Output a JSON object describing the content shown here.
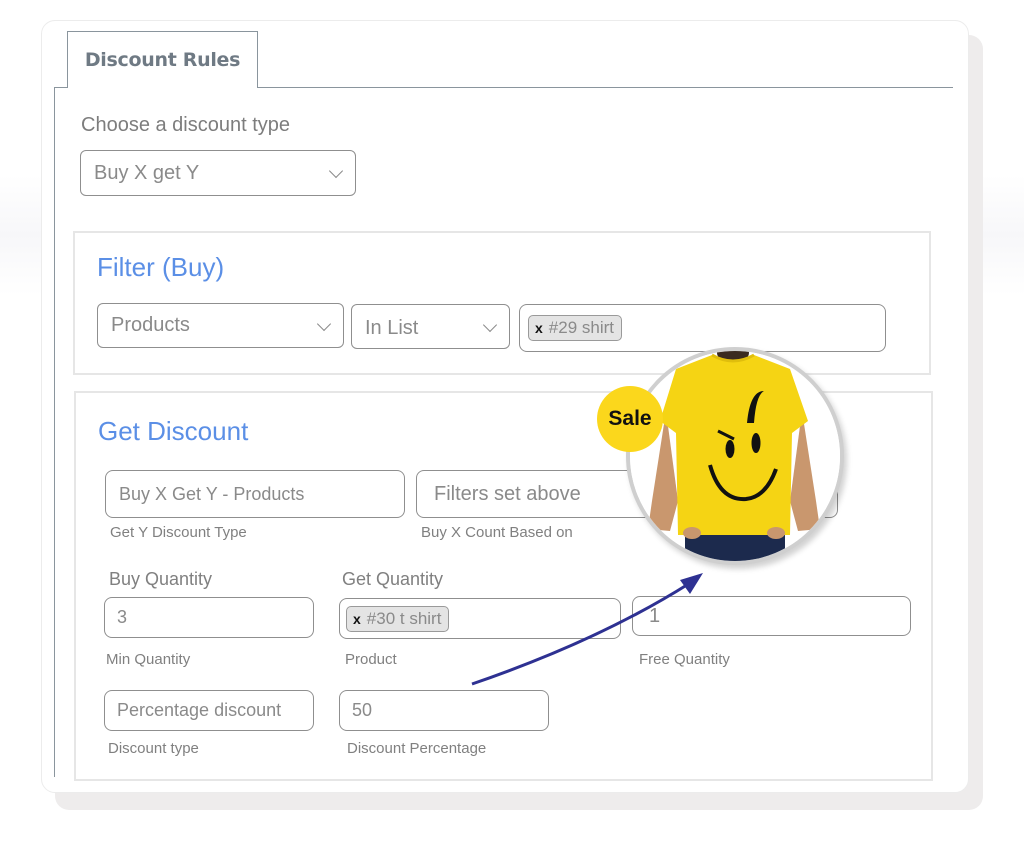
{
  "tab": {
    "label": "Discount Rules"
  },
  "discount_type": {
    "label": "Choose a discount type",
    "selected": "Buy X get Y"
  },
  "filter_section": {
    "title": "Filter (Buy)",
    "filter_type": "Products",
    "condition": "In List",
    "chips": [
      {
        "remove": "x",
        "label": "#29 shirt"
      }
    ]
  },
  "get_discount_section": {
    "title": "Get Discount",
    "get_y_type": {
      "value": "Buy X Get Y - Products",
      "help": "Get Y Discount Type"
    },
    "count_based_on": {
      "value": "Filters set above",
      "help": "Buy X Count Based on"
    },
    "buy_quantity": {
      "label": "Buy Quantity",
      "value": "3",
      "help": "Min Quantity"
    },
    "get_quantity": {
      "label": "Get Quantity",
      "chips": [
        {
          "remove": "x",
          "label": "#30 t shirt"
        }
      ],
      "help": "Product"
    },
    "free_quantity": {
      "value": "1",
      "help": "Free Quantity"
    },
    "discount_type": {
      "value": "Percentage discount",
      "help": "Discount type"
    },
    "discount_percentage": {
      "value": "50",
      "help": "Discount Percentage"
    }
  },
  "promo": {
    "badge": "Sale",
    "image": "yellow-smiley-tshirt",
    "colors": {
      "badge": "#fbd71c",
      "shirt": "#f7d417",
      "arrow": "#2e3192"
    }
  },
  "colors": {
    "accent": "#5b8fe6",
    "tab_border": "#8a959d"
  }
}
